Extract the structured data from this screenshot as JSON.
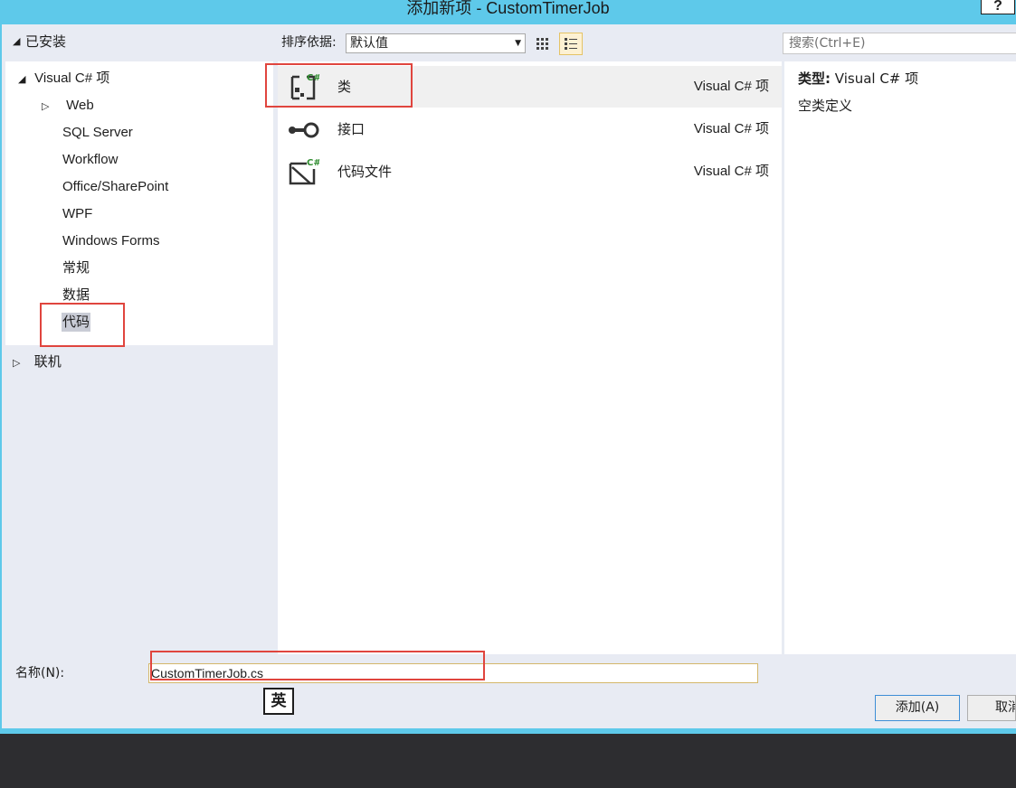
{
  "window": {
    "title": "添加新项 - CustomTimerJob",
    "help_label": "?"
  },
  "left": {
    "header": "已安装",
    "tree": [
      {
        "label": "Visual C# 项",
        "expanded": true
      },
      {
        "label": "Web",
        "collapsed": true
      },
      {
        "label": "SQL Server"
      },
      {
        "label": "Workflow"
      },
      {
        "label": "Office/SharePoint"
      },
      {
        "label": "WPF"
      },
      {
        "label": "Windows Forms"
      },
      {
        "label": "常规"
      },
      {
        "label": "数据"
      },
      {
        "label": "代码",
        "selected": true
      }
    ],
    "online": "联机"
  },
  "toolbar": {
    "sort_label": "排序依据:",
    "sort_value": "默认值",
    "search_placeholder": "搜索(Ctrl+E)"
  },
  "templates": [
    {
      "name": "类",
      "type": "Visual C# 项",
      "icon": "class-icon",
      "selected": true
    },
    {
      "name": "接口",
      "type": "Visual C# 项",
      "icon": "interface-icon"
    },
    {
      "name": "代码文件",
      "type": "Visual C# 项",
      "icon": "code-file-icon"
    }
  ],
  "detail": {
    "type_label": "类型:",
    "type_value": "Visual C# 项",
    "description": "空类定义"
  },
  "bottom": {
    "name_label": "名称(N):",
    "name_value": "CustomTimerJob.cs",
    "ime_label": "英",
    "add_button": "添加(A)",
    "cancel_button": "取消"
  },
  "colors": {
    "title_bar": "#5ec9ea",
    "highlight_box": "#e0453e",
    "csharp_badge": "#2e8b2e"
  }
}
